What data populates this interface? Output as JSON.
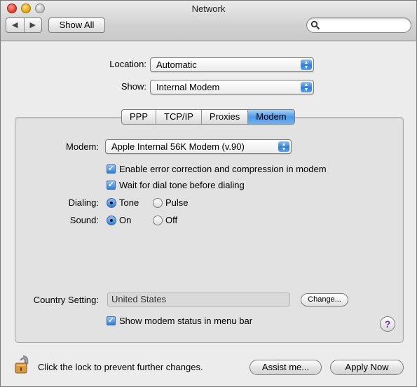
{
  "window": {
    "title": "Network"
  },
  "toolbar": {
    "back_label": "◀",
    "forward_label": "▶",
    "show_all_label": "Show All",
    "search": {
      "value": "",
      "placeholder": ""
    }
  },
  "location": {
    "label": "Location:",
    "value": "Automatic"
  },
  "show": {
    "label": "Show:",
    "value": "Internal Modem"
  },
  "tabs": [
    {
      "label": "PPP",
      "active": false
    },
    {
      "label": "TCP/IP",
      "active": false
    },
    {
      "label": "Proxies",
      "active": false
    },
    {
      "label": "Modem",
      "active": true
    }
  ],
  "modem": {
    "label": "Modem:",
    "value": "Apple Internal 56K Modem (v.90)"
  },
  "checkboxes": {
    "error_correction": {
      "label": "Enable error correction and compression in modem",
      "checked": true
    },
    "dial_tone": {
      "label": "Wait for dial tone before dialing",
      "checked": true
    },
    "menu_bar_status": {
      "label": "Show modem status in menu bar",
      "checked": true
    }
  },
  "dialing": {
    "label": "Dialing:",
    "options": [
      {
        "label": "Tone",
        "selected": true
      },
      {
        "label": "Pulse",
        "selected": false
      }
    ]
  },
  "sound": {
    "label": "Sound:",
    "options": [
      {
        "label": "On",
        "selected": true
      },
      {
        "label": "Off",
        "selected": false
      }
    ]
  },
  "country": {
    "label": "Country Setting:",
    "value": "United States",
    "change_label": "Change..."
  },
  "help_label": "?",
  "footer": {
    "lock_text": "Click the lock to prevent further changes.",
    "assist_label": "Assist me...",
    "apply_label": "Apply Now"
  },
  "colors": {
    "accent": "#2f7fd8",
    "help": "#6b2fb0"
  },
  "icons": {
    "lock": "lock-icon",
    "search": "search-icon"
  }
}
